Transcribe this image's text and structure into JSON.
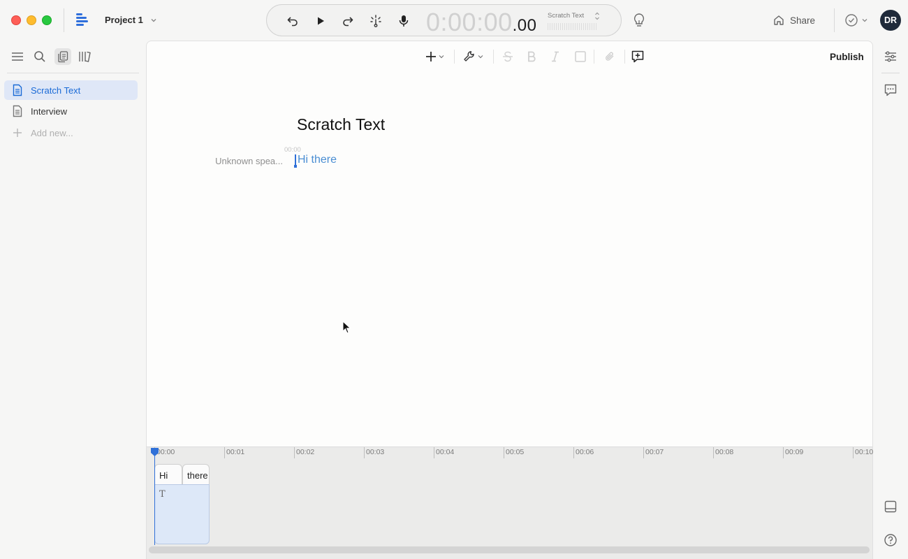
{
  "titlebar": {
    "project_title": "Project 1",
    "timecode_main": "0:00:00",
    "timecode_frac": ".00",
    "current_doc": "Scratch Text",
    "share_label": "Share",
    "avatar_initials": "DR"
  },
  "colors": {
    "accent": "#1a6ad6",
    "selected_bg": "#dfe7f7",
    "clip_bg": "#dde8f8",
    "playhead": "#2f70d8"
  },
  "sidebar": {
    "documents": [
      {
        "label": "Scratch Text",
        "icon": "document-icon",
        "selected": true
      },
      {
        "label": "Interview",
        "icon": "document-icon",
        "selected": false
      }
    ],
    "add_new_label": "Add new..."
  },
  "toolbar": {
    "publish_label": "Publish"
  },
  "document": {
    "title": "Scratch Text",
    "timestamp": "00:00",
    "speaker": "Unknown spea...",
    "text": "Hi there"
  },
  "timeline": {
    "ticks": [
      "00:00",
      "00:01",
      "00:02",
      "00:03",
      "00:04",
      "00:05",
      "00:06",
      "00:07",
      "00:08",
      "00:09",
      "00:10"
    ],
    "words": [
      "Hi",
      "there"
    ],
    "clip_glyph": "T"
  }
}
